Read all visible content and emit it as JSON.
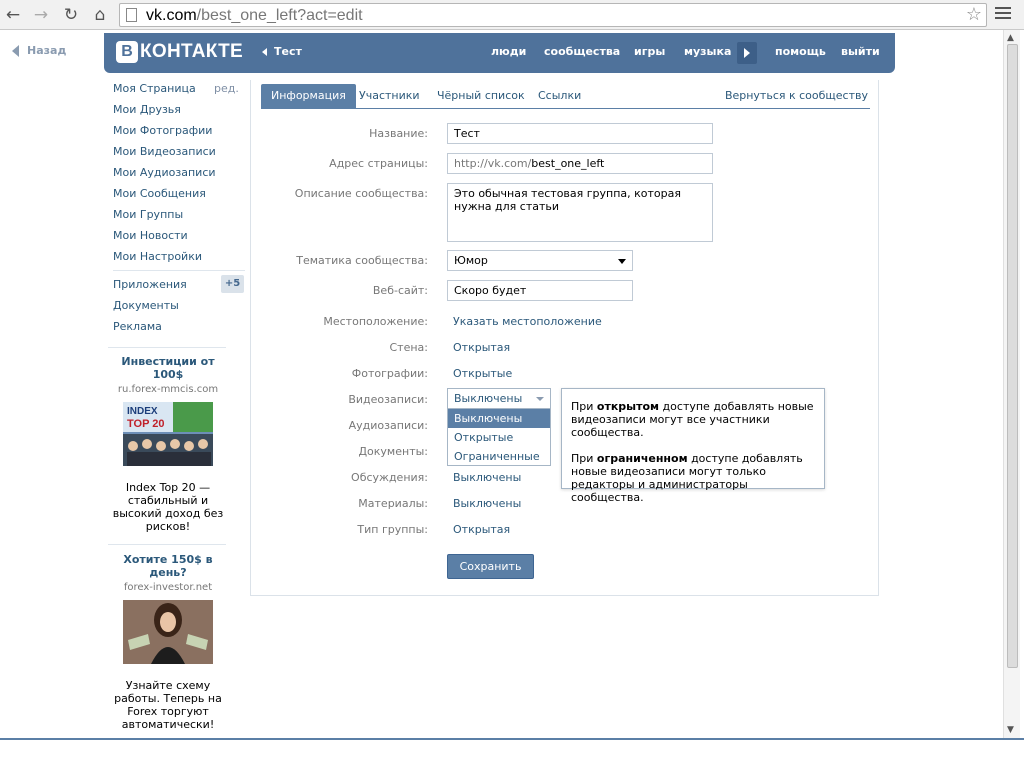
{
  "browser": {
    "url_host": "vk.com",
    "url_path": "/best_one_left?act=edit"
  },
  "nav": {
    "back_label": "Назад"
  },
  "header": {
    "logo_letter": "В",
    "logo_text": "КОНТАКТЕ",
    "group_name": "Тест",
    "links": [
      "люди",
      "сообщества",
      "игры",
      "музыка",
      "помощь",
      "выйти"
    ]
  },
  "sidebar": {
    "items": [
      "Моя Страница",
      "Мои Друзья",
      "Мои Фотографии",
      "Мои Видеозаписи",
      "Мои Аудиозаписи",
      "Мои Сообщения",
      "Мои Группы",
      "Мои Новости",
      "Мои Настройки"
    ],
    "edit_label": "ред.",
    "apps_label": "Приложения",
    "apps_badge": "+5",
    "docs_label": "Документы",
    "ads_label": "Реклама"
  },
  "ads": [
    {
      "title": "Инвестиции от 100$",
      "domain": "ru.forex-mmcis.com",
      "img_text_top": "INDEX",
      "img_text_bottom": "TOP 20",
      "text": "Index Top 20 — стабильный и высокий доход без рисков!"
    },
    {
      "title": "Хотите 150$ в день?",
      "domain": "forex-investor.net",
      "text": "Узнайте схему работы. Теперь на Forex торгуют автоматически!"
    }
  ],
  "tabs": {
    "items": [
      "Информация",
      "Участники",
      "Чёрный список",
      "Ссылки"
    ],
    "active": "Информация",
    "back": "Вернуться к сообществу"
  },
  "form": {
    "name_label": "Название:",
    "name_value": "Тест",
    "address_label": "Адрес страницы:",
    "address_prefix": "http://vk.com/",
    "address_value": "best_one_left",
    "desc_label": "Описание сообщества:",
    "desc_value": "Это обычная тестовая группа, которая нужна для статьи",
    "topic_label": "Тематика сообщества:",
    "topic_value": "Юмор",
    "site_label": "Веб-сайт:",
    "site_value": "Скоро будет",
    "location_label": "Местоположение:",
    "location_value": "Указать местоположение",
    "wall_label": "Стена:",
    "wall_value": "Открытая",
    "photos_label": "Фотографии:",
    "photos_value": "Открытые",
    "videos_label": "Видеозаписи:",
    "videos_value": "Выключены",
    "videos_options": [
      "Выключены",
      "Открытые",
      "Ограниченные"
    ],
    "audio_label": "Аудиозаписи:",
    "docs_label": "Документы:",
    "discussions_label": "Обсуждения:",
    "discussions_value": "Выключены",
    "materials_label": "Материалы:",
    "materials_value": "Выключены",
    "group_type_label": "Тип группы:",
    "group_type_value": "Открытая",
    "save_label": "Сохранить"
  },
  "tooltip": {
    "p1_pre": "При ",
    "p1_bold": "открытом",
    "p1_post": " доступе добавлять новые видеозаписи могут все участники сообщества.",
    "p2_pre": "При ",
    "p2_bold": "ограниченном",
    "p2_post": " доступе добавлять новые видеозаписи могут только редакторы и администраторы сообщества."
  },
  "colors": {
    "vk_blue": "#4f729b",
    "link": "#2b587a",
    "accent": "#5b7fa6"
  }
}
